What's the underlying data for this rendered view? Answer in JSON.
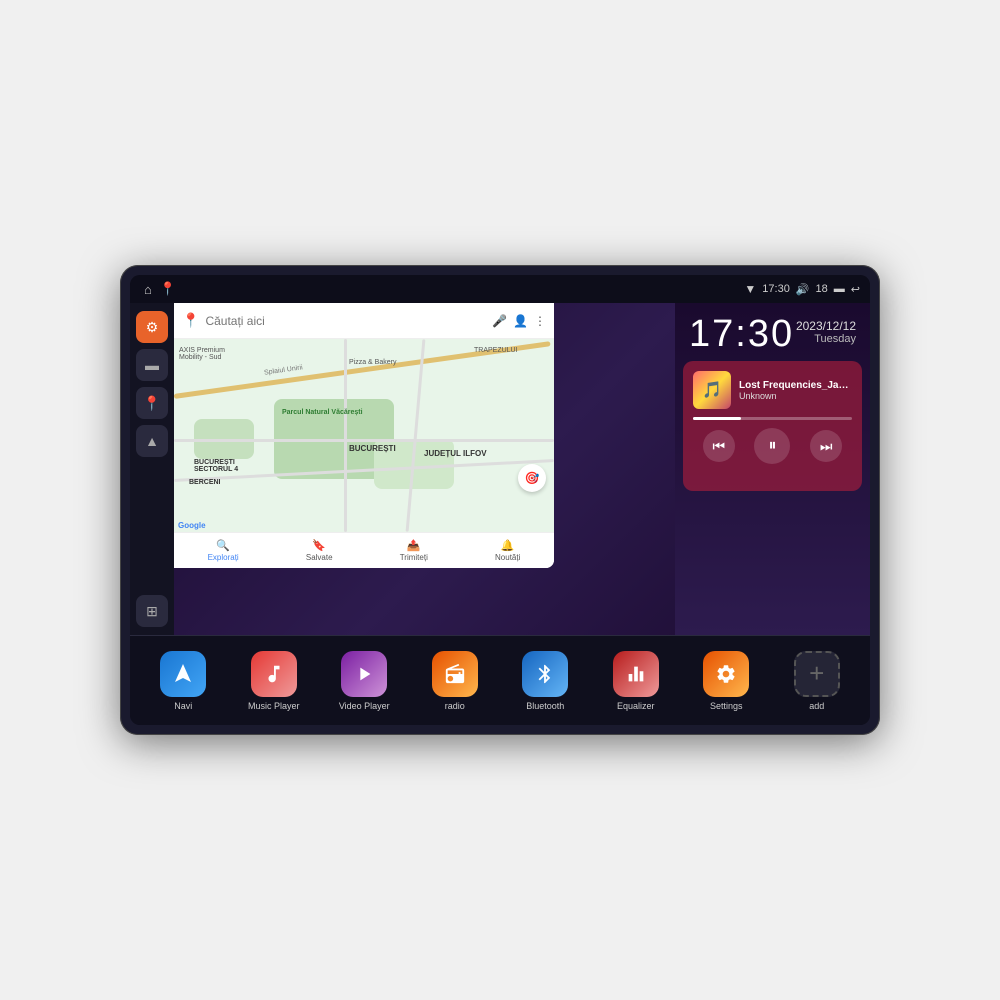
{
  "device": {
    "status_bar": {
      "wifi_signal": "▼",
      "time": "17:30",
      "volume_icon": "🔊",
      "battery_level": "18",
      "battery_icon": "🔋",
      "back_icon": "↩"
    },
    "clock": {
      "time": "17:30",
      "date": "2023/12/12",
      "day": "Tuesday"
    },
    "music": {
      "title": "Lost Frequencies_Janie...",
      "artist": "Unknown",
      "album_art_emoji": "🎵"
    },
    "map": {
      "search_placeholder": "Căutați aici",
      "tabs": [
        {
          "label": "Explorați",
          "icon": "🔍",
          "active": true
        },
        {
          "label": "Salvate",
          "icon": "🔖",
          "active": false
        },
        {
          "label": "Trimiteți",
          "icon": "📤",
          "active": false
        },
        {
          "label": "Noutăți",
          "icon": "🔔",
          "active": false
        }
      ],
      "labels": [
        {
          "text": "Parcul Natural Văcărești"
        },
        {
          "text": "BUCUREȘTI"
        },
        {
          "text": "SECTORUL 4"
        },
        {
          "text": "JUDEȚUL ILFOV"
        },
        {
          "text": "BERCENI"
        },
        {
          "text": "Pizza & Bakery"
        },
        {
          "text": "AXIS Premium Mobility - Sud"
        },
        {
          "text": "Splaiul Unirii"
        },
        {
          "text": "TRAPEZULUI"
        }
      ]
    },
    "sidebar": {
      "buttons": [
        {
          "icon": "⚙️",
          "style": "orange"
        },
        {
          "icon": "📁",
          "style": "dark"
        },
        {
          "icon": "📍",
          "style": "dark"
        },
        {
          "icon": "▲",
          "style": "dark"
        },
        {
          "icon": "⊞",
          "style": "grid"
        }
      ]
    },
    "apps": [
      {
        "id": "navi",
        "label": "Navi",
        "icon": "▲",
        "style": "navi"
      },
      {
        "id": "music-player",
        "label": "Music Player",
        "icon": "🎵",
        "style": "music"
      },
      {
        "id": "video-player",
        "label": "Video Player",
        "icon": "▶",
        "style": "video"
      },
      {
        "id": "radio",
        "label": "radio",
        "icon": "📻",
        "style": "radio"
      },
      {
        "id": "bluetooth",
        "label": "Bluetooth",
        "icon": "⚡",
        "style": "bluetooth"
      },
      {
        "id": "equalizer",
        "label": "Equalizer",
        "icon": "🎚",
        "style": "equalizer"
      },
      {
        "id": "settings",
        "label": "Settings",
        "icon": "⚙",
        "style": "settings"
      },
      {
        "id": "add",
        "label": "add",
        "icon": "+",
        "style": "add"
      }
    ]
  }
}
